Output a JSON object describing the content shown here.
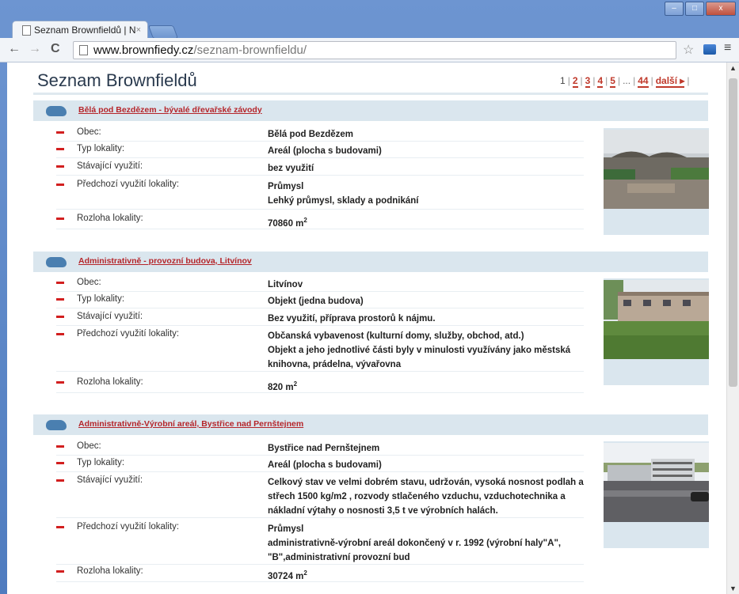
{
  "browser": {
    "tab_title": "Seznam Brownfieldů | N",
    "tab_close": "×",
    "url_host": "www.brownfiedy.cz",
    "url_path": "/seznam-brownfieldu/",
    "back_icon": "←",
    "forward_icon": "→",
    "reload_icon": "C",
    "star_icon": "☆",
    "menu_icon": "≡",
    "win_min": "–",
    "win_max": "□",
    "win_close": "x"
  },
  "page": {
    "title": "Seznam Brownfieldů",
    "pager": {
      "current": "1",
      "pages": [
        "2",
        "3",
        "4",
        "5"
      ],
      "ellipsis": "...",
      "last": "44",
      "next": "další ▸"
    }
  },
  "labels": {
    "obec": "Obec:",
    "typ": "Typ lokality:",
    "stavajici": "Stávající využití:",
    "predchozi": "Předchozí využití lokality:",
    "rozloha": "Rozloha lokality:"
  },
  "items": [
    {
      "name": "Bělá pod Bezdězem - bývalé dřevařské závody",
      "obec": "Bělá pod Bezdězem",
      "typ": "Areál (plocha s budovami)",
      "stavajici": "bez využití",
      "predchozi": "Průmysl",
      "predchozi_detail": "Lehký průmysl, sklady a podnikání",
      "rozloha": "70860 m",
      "rozloha_unit": "2"
    },
    {
      "name": "Administrativně - provozní budova, Litvínov",
      "obec": "Litvínov",
      "typ": "Objekt (jedna budova)",
      "stavajici": "Bez využití, příprava prostorů k nájmu.",
      "predchozi": "Občanská vybavenost (kulturní domy, služby, obchod, atd.)",
      "predchozi_detail": "Objekt a jeho jednotlivé části byly v minulosti využívány jako městská knihovna, prádelna, vývařovna",
      "rozloha": "820 m",
      "rozloha_unit": "2"
    },
    {
      "name": "Administrativně-Výrobní areál, Bystřice nad Pernštejnem",
      "obec": "Bystřice nad Pernštejnem",
      "typ": "Areál (plocha s budovami)",
      "stavajici": "Celkový stav ve velmi dobrém stavu, udržován, vysoká nosnost podlah a střech 1500 kg/m2 , rozvody stlačeného vzduchu, vzduchotechnika a nákladní výtahy o nosnosti 3,5 t ve výrobních halách.",
      "predchozi": "Průmysl",
      "predchozi_detail": "administrativně-výrobní areál dokončený v r. 1992 (výrobní haly\"A\", \"B\",administrativní provozní bud",
      "rozloha": "30724 m",
      "rozloha_unit": "2"
    }
  ]
}
